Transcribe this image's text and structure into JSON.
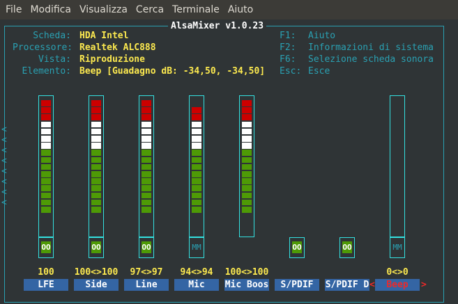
{
  "menu": [
    "File",
    "Modifica",
    "Visualizza",
    "Cerca",
    "Terminale",
    "Aiuto"
  ],
  "title": "AlsaMixer v1.0.23",
  "info": [
    {
      "label": "Scheda:",
      "value": "HDA Intel"
    },
    {
      "label": "Processore:",
      "value": "Realtek ALC888"
    },
    {
      "label": "Vista:",
      "value": "Riproduzione"
    },
    {
      "label": "Elemento:",
      "value": "Beep [Guadagno dB: -34,50, -34,50]"
    }
  ],
  "keys": [
    {
      "key": "F1:",
      "desc": "Aiuto"
    },
    {
      "key": "F2:",
      "desc": "Informazioni di sistema"
    },
    {
      "key": "F6:",
      "desc": "Selezione scheda sonora"
    },
    {
      "key": "Esc:",
      "desc": "Esce"
    }
  ],
  "channels": [
    {
      "name": "LFE",
      "volume": "100",
      "level": 1.0,
      "state": "OO",
      "has_meter": true
    },
    {
      "name": "Side",
      "volume": "100<>100",
      "level": 1.0,
      "state": "OO",
      "has_meter": true
    },
    {
      "name": "Line",
      "volume": "97<>97",
      "level": 0.97,
      "state": "OO",
      "has_meter": true
    },
    {
      "name": "Mic",
      "volume": "94<>94",
      "level": 0.94,
      "state": "MM",
      "has_meter": true
    },
    {
      "name": "Mic Boos",
      "volume": "100<>100",
      "level": 1.0,
      "state": "",
      "has_meter": true
    },
    {
      "name": "S/PDIF",
      "volume": "",
      "level": 0,
      "state": "OO",
      "has_meter": false
    },
    {
      "name": "S/PDIF D",
      "volume": "",
      "level": 0,
      "state": "OO",
      "has_meter": false
    },
    {
      "name": "Beep",
      "volume": "0<>0",
      "level": 0.0,
      "state": "MM",
      "has_meter": true,
      "selected": true
    }
  ],
  "colors": {
    "cyan": "#2aa1b3",
    "yellow": "#fce94f",
    "blue": "#3465a4",
    "red": "#cc0000",
    "green": "#4e9a06"
  }
}
